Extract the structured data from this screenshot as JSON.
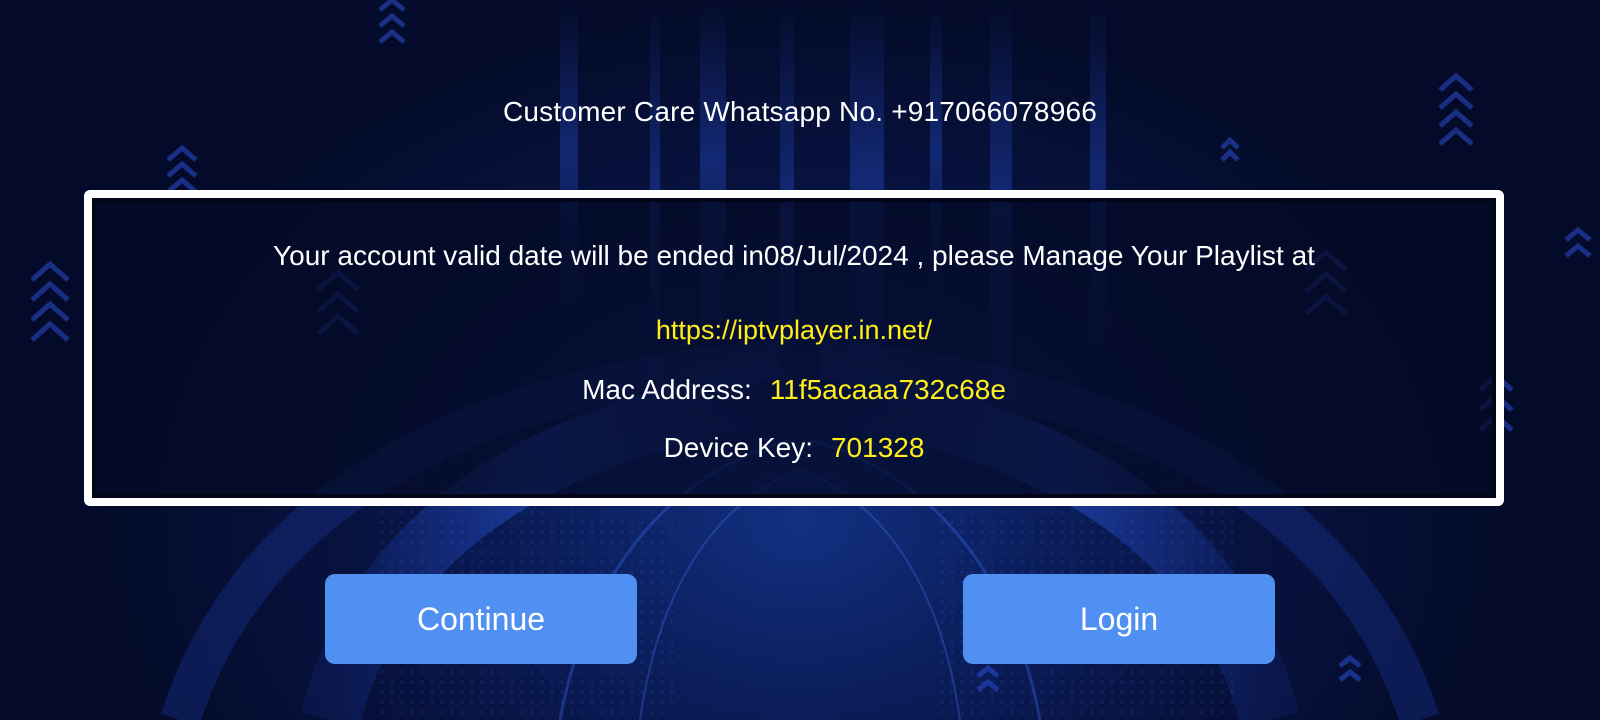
{
  "header": {
    "customer_care": "Customer Care Whatsapp No. +917066078966"
  },
  "account_panel": {
    "expiry_message": "Your account valid date will be ended in08/Jul/2024 , please Manage Your Playlist at",
    "playlist_url": "https://iptvplayer.in.net/",
    "mac_address_label": "Mac Address:",
    "mac_address_value": "11f5acaaa732c68e",
    "device_key_label": "Device Key:",
    "device_key_value": "701328"
  },
  "actions": {
    "continue_label": "Continue",
    "login_label": "Login"
  },
  "colors": {
    "background": "#050d2e",
    "accent_text": "#ffee1a",
    "button": "#5090f2",
    "panel_border": "#ffffff"
  }
}
